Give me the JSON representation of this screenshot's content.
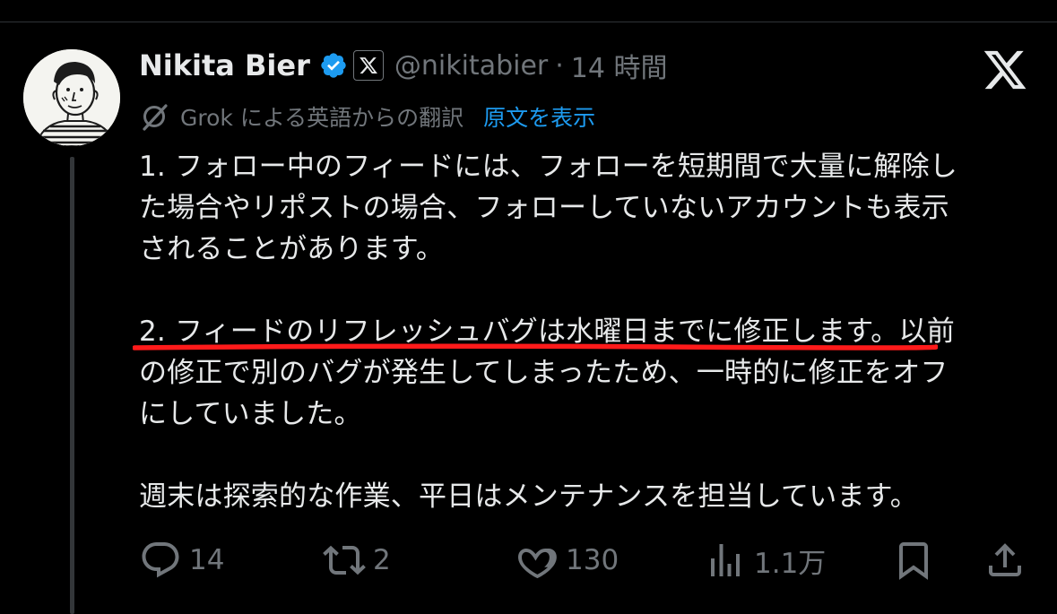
{
  "tweet": {
    "display_name": "Nikita Bier",
    "handle": "@nikitabier",
    "separator": "·",
    "time": "14 時間"
  },
  "translation": {
    "label": "Grok による英語からの翻訳",
    "show_original": "原文を表示"
  },
  "body": {
    "paragraph1": [
      "1. フォロー中のフィードには、フォローを短期間で大量に解除し",
      "た場合やリポストの場合、フォローしていないアカウントも表示",
      "されることがあります。"
    ],
    "paragraph2": [
      "2. フィードのリフレッシュバグは水曜日までに修正します。以前",
      "の修正で別のバグが発生してしまったため、一時的に修正をオフ",
      "にしていました。"
    ],
    "paragraph3": [
      "週末は探索的な作業、平日はメンテナンスを担当しています。"
    ]
  },
  "actions": {
    "reply_count": "14",
    "repost_count": "2",
    "like_count": "130",
    "view_count": "1.1万"
  },
  "icons": {
    "verified": "verified-badge-icon",
    "affiliate": "x-affiliate-icon",
    "logo": "x-logo-icon",
    "translate": "grok-icon",
    "reply": "reply-icon",
    "repost": "repost-icon",
    "like": "heart-icon",
    "views": "views-icon",
    "bookmark": "bookmark-icon",
    "share": "share-icon"
  },
  "colors": {
    "background": "#000000",
    "text": "#e7e9ea",
    "secondary": "#71767b",
    "link": "#1d9bf0",
    "verified": "#1d9bf0",
    "highlight": "#ff1a1a"
  }
}
